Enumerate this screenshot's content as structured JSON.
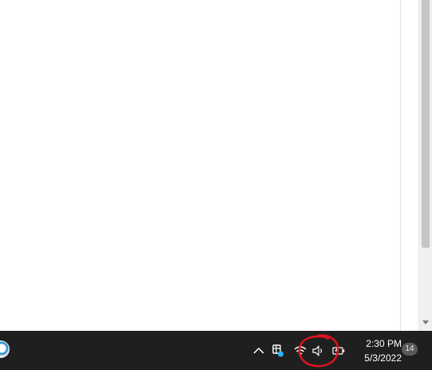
{
  "taskbar": {
    "clock": {
      "time": "2:30 PM",
      "date": "5/3/2022"
    },
    "notification_count": "14",
    "tray_icons": [
      "chevron-up-icon",
      "onedrive-icon",
      "wifi-icon",
      "volume-icon",
      "battery-icon"
    ],
    "annotation_color": "#e0141e"
  },
  "colors": {
    "taskbar_background": "#1f1f1f",
    "content_background": "#ffffff",
    "scrollbar_thumb": "#c5c5c5"
  }
}
